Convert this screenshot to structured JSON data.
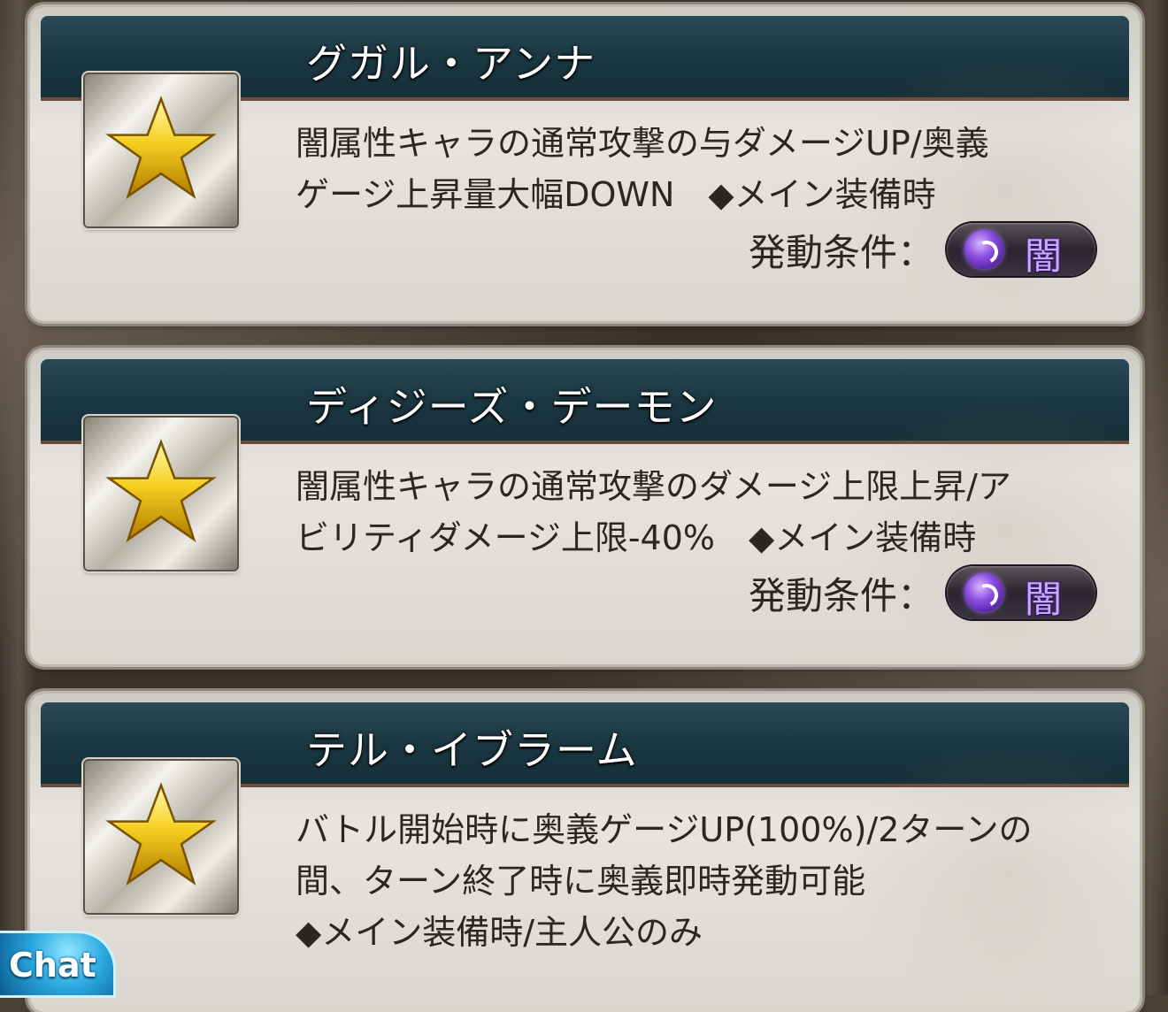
{
  "skills": [
    {
      "name": "グガル・アンナ",
      "description_lines": [
        "闇属性キャラの通常攻撃の与ダメージUP/奥義",
        "ゲージ上昇量大幅DOWN　◆メイン装備時"
      ],
      "trigger_label": "発動条件：",
      "element": "闇"
    },
    {
      "name": "ディジーズ・デーモン",
      "description_lines": [
        "闇属性キャラの通常攻撃のダメージ上限上昇/ア",
        "ビリティダメージ上限-40%　◆メイン装備時"
      ],
      "trigger_label": "発動条件：",
      "element": "闇"
    },
    {
      "name": "テル・イブラーム",
      "description_lines": [
        "バトル開始時に奥義ゲージUP(100%)/2ターンの",
        "間、ターン終了時に奥義即時発動可能",
        "◆メイン装備時/主人公のみ"
      ]
    }
  ],
  "chat": {
    "label": "Chat"
  },
  "colors": {
    "header": "#1a3640",
    "element_dark": "#8c4fe0",
    "star": "#f5d020"
  }
}
